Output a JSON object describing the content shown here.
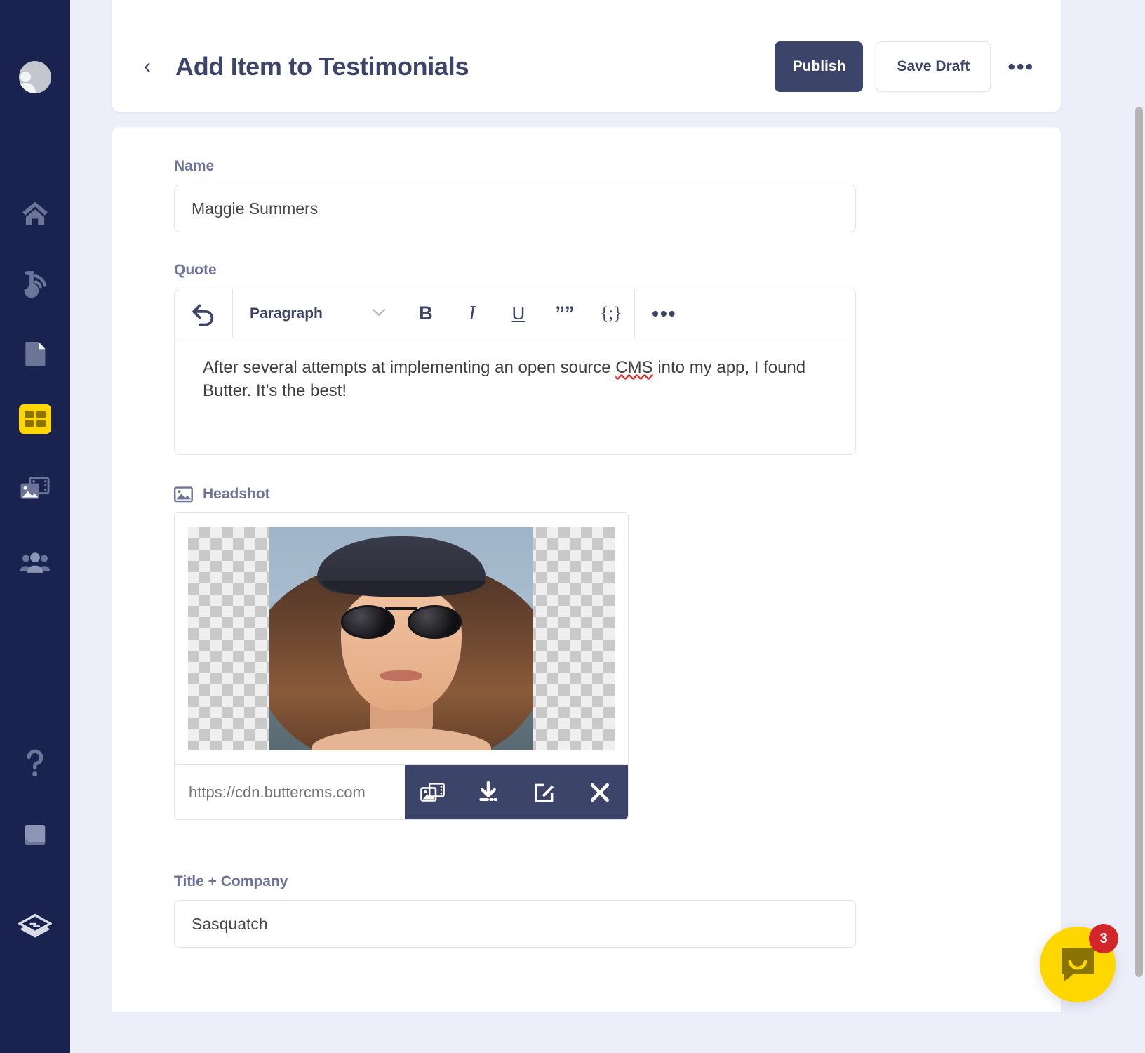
{
  "sidebar": {
    "items": [
      {
        "name": "user-avatar",
        "icon": "avatar-icon",
        "label": "Account",
        "active": false
      },
      {
        "name": "home",
        "icon": "home-icon",
        "label": "Home",
        "active": false
      },
      {
        "name": "blog",
        "icon": "blog-icon",
        "label": "Blog",
        "active": false
      },
      {
        "name": "pages",
        "icon": "page-icon",
        "label": "Pages",
        "active": false
      },
      {
        "name": "collections",
        "icon": "collections-grid-icon",
        "label": "Collections",
        "active": true
      },
      {
        "name": "media",
        "icon": "media-library-icon",
        "label": "Media",
        "active": false
      },
      {
        "name": "team",
        "icon": "team-users-icon",
        "label": "Team",
        "active": false
      },
      {
        "name": "help",
        "icon": "question-mark-icon",
        "label": "Help",
        "active": false
      },
      {
        "name": "docs",
        "icon": "book-icon",
        "label": "Docs",
        "active": false
      },
      {
        "name": "brand-logo",
        "icon": "layers-logo-icon",
        "label": "Butter CMS",
        "active": false
      }
    ],
    "background_color": "#1a2350",
    "active_color": "#ffd700"
  },
  "header": {
    "back_label": "‹",
    "title": "Add Item to Testimonials",
    "publish_label": "Publish",
    "save_draft_label": "Save Draft",
    "more_label": "•••",
    "publish_color": "#3d4469"
  },
  "form": {
    "name": {
      "label": "Name",
      "value": "Maggie Summers",
      "placeholder": "Name"
    },
    "quote": {
      "label": "Quote",
      "toolbar": {
        "undo": "undo-icon",
        "block_format": "Paragraph",
        "chevron": "⌄",
        "bold": "B",
        "italic": "I",
        "underline": "U",
        "blockquote": "””",
        "code": "{;}",
        "overflow": "•••"
      },
      "text_part_1": "After several attempts at implementing an open source ",
      "text_misspelled": "CMS",
      "text_part_2": " into my app, I found Butter. It’s the best!"
    },
    "headshot": {
      "label": "Headshot",
      "icon": "image-icon",
      "url_value": "https://cdn.buttercms.com",
      "url_placeholder": "https://cdn.buttercms.com",
      "actions": [
        {
          "name": "choose-from-library",
          "icon": "media-library-icon",
          "label": "Library"
        },
        {
          "name": "download-image",
          "icon": "download-icon",
          "label": "Download"
        },
        {
          "name": "edit-image",
          "icon": "edit-pencil-icon",
          "label": "Edit"
        },
        {
          "name": "remove-image",
          "icon": "close-x-icon",
          "label": "Remove"
        }
      ],
      "toolbar_color": "#3d4469"
    },
    "title_company": {
      "label": "Title + Company",
      "value": "Sasquatch",
      "placeholder": "Title + Company"
    }
  },
  "chat": {
    "badge_count": "3",
    "icon": "chat-bubble-icon",
    "button_color": "#ffd700",
    "badge_color": "#d3262a"
  }
}
